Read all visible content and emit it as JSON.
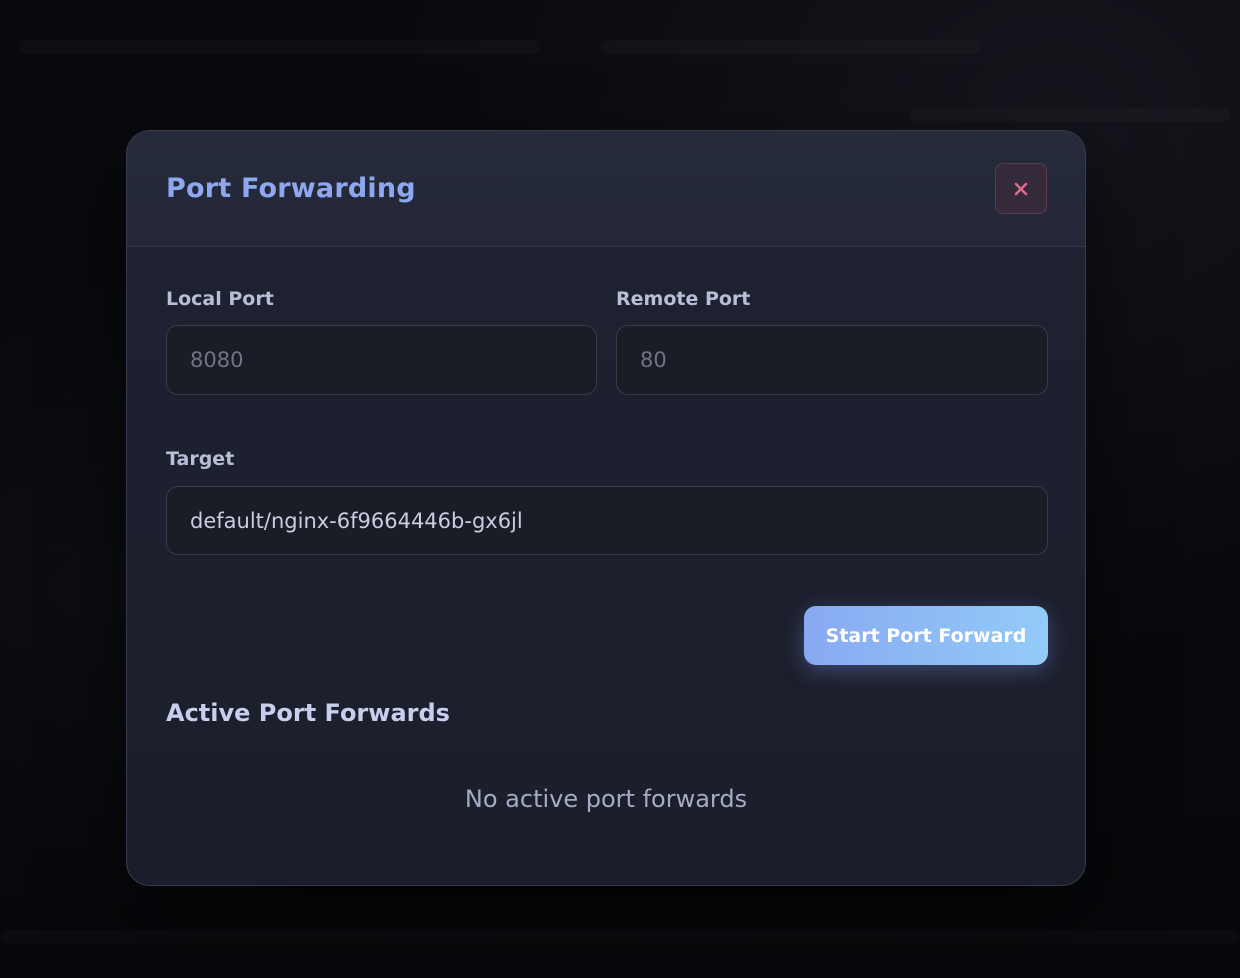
{
  "dialog": {
    "title": "Port Forwarding",
    "close_icon": "close-icon"
  },
  "form": {
    "local_port": {
      "label": "Local Port",
      "placeholder": "8080",
      "value": ""
    },
    "remote_port": {
      "label": "Remote Port",
      "placeholder": "80",
      "value": ""
    },
    "target": {
      "label": "Target",
      "value": "default/nginx-6f9664446b-gx6jl"
    },
    "submit_label": "Start Port Forward"
  },
  "active_forwards": {
    "title": "Active Port Forwards",
    "empty_message": "No active port forwards",
    "items": []
  },
  "colors": {
    "accent": "#8ea7ef",
    "button_gradient_start": "#88a9f2",
    "button_gradient_end": "#93cbf7",
    "close_icon": "#e06c8c"
  }
}
